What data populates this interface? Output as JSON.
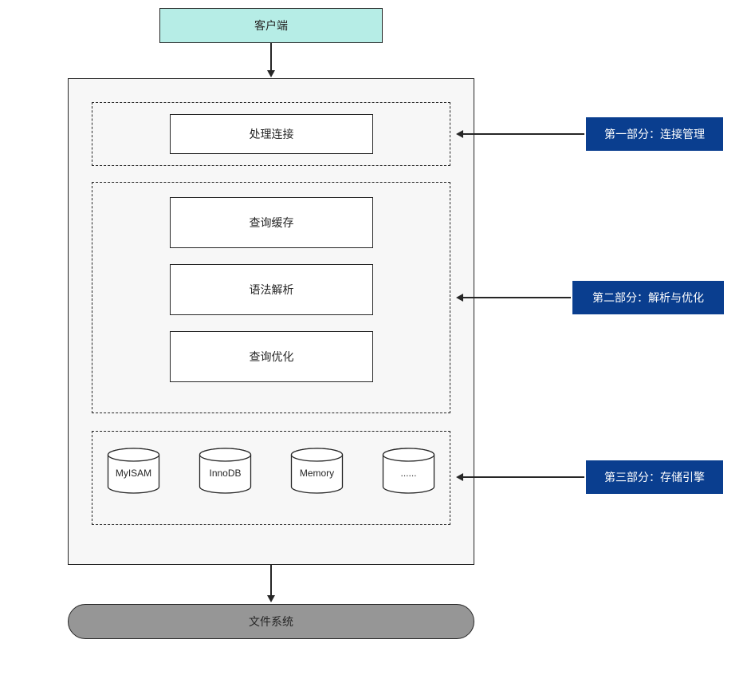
{
  "client_label": "客户端",
  "section1": {
    "box": "处理连接",
    "annotation": "第一部分：连接管理"
  },
  "section2": {
    "boxes": [
      "查询缓存",
      "语法解析",
      "查询优化"
    ],
    "annotation": "第二部分：解析与优化"
  },
  "section3": {
    "engines": [
      "MyISAM",
      "InnoDB",
      "Memory",
      "......"
    ],
    "annotation": "第三部分：存储引擎"
  },
  "file_system_label": "文件系统",
  "colors": {
    "client_bg": "#b6ede6",
    "anno_bg": "#0a3e8f",
    "file_sys_bg": "#969696",
    "main_bg": "#f7f7f7"
  }
}
